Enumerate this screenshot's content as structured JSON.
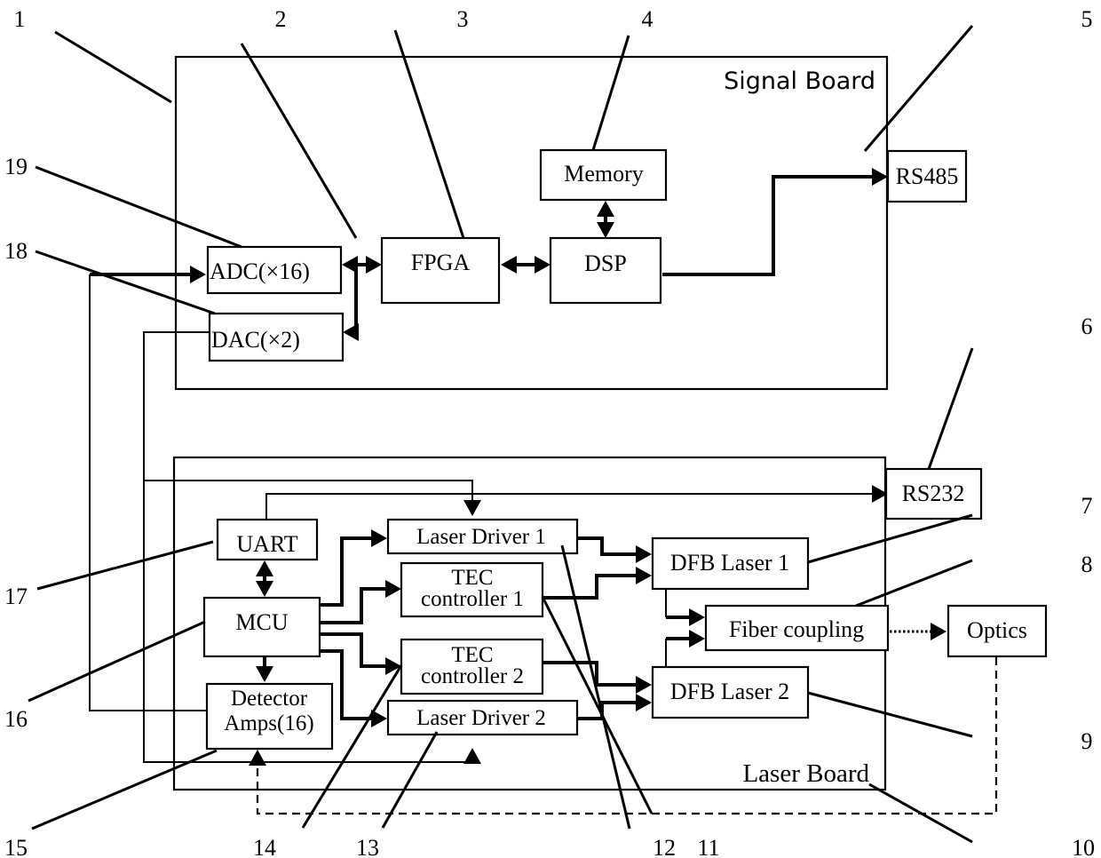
{
  "diagram": {
    "boards": {
      "signal": "Signal Board",
      "laser": "Laser Board"
    },
    "blocks": {
      "fpga": "FPGA",
      "memory": "Memory",
      "dsp": "DSP",
      "rs485": "RS485",
      "adc": "ADC(×16)",
      "dac": "DAC(×2)",
      "uart": "UART",
      "mcu": "MCU",
      "detector_line1": "Detector",
      "detector_line2": "Amps(16)",
      "laser_driver_1": "Laser Driver 1",
      "tec1_line1": "TEC",
      "tec1_line2": "controller 1",
      "tec2_line1": "TEC",
      "tec2_line2": "controller 2",
      "laser_driver_2": "Laser Driver 2",
      "rs232": "RS232",
      "dfb_laser_1": "DFB Laser 1",
      "dfb_laser_2": "DFB Laser 2",
      "fiber_coupling": "Fiber coupling",
      "optics": "Optics"
    },
    "callouts": [
      "1",
      "2",
      "3",
      "4",
      "5",
      "6",
      "7",
      "8",
      "9",
      "10",
      "11",
      "12",
      "13",
      "14",
      "15",
      "16",
      "17",
      "18",
      "19"
    ]
  }
}
